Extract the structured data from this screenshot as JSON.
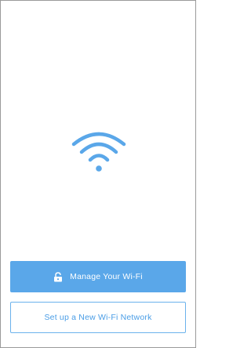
{
  "colors": {
    "accent": "#5aa7e9",
    "accent_text": "#4a9de6",
    "background": "#ffffff"
  },
  "hero": {
    "icon": "wifi-icon"
  },
  "actions": {
    "manage": {
      "label": "Manage Your Wi-Fi",
      "icon": "lock-icon"
    },
    "setup": {
      "label": "Set up a New Wi-Fi Network"
    }
  }
}
